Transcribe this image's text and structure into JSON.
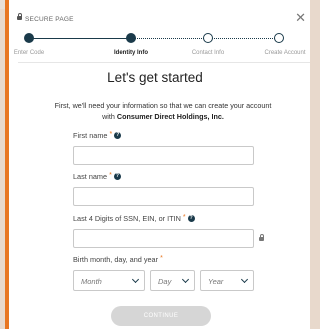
{
  "header": {
    "secure_label": "SECURE PAGE",
    "close_icon": "close-icon"
  },
  "steps": [
    {
      "label": "Enter Code",
      "state": "completed"
    },
    {
      "label": "Identity Info",
      "state": "current"
    },
    {
      "label": "Contact Info",
      "state": "upcoming"
    },
    {
      "label": "Create Account",
      "state": "upcoming"
    }
  ],
  "title": "Let's get started",
  "intro": {
    "text": "First, we'll need your information so that we can create your account with ",
    "company": "Consumer Direct Holdings, Inc."
  },
  "fields": {
    "first_name": {
      "label": "First name",
      "required": "*",
      "value": ""
    },
    "last_name": {
      "label": "Last name",
      "required": "*",
      "value": ""
    },
    "ssn": {
      "label": "Last 4 Digits of SSN, EIN, or ITIN",
      "required": "*",
      "value": ""
    },
    "birth": {
      "label": "Birth month, day, and year",
      "required": "*"
    }
  },
  "birth_selects": {
    "month": "Month",
    "day": "Day",
    "year": "Year"
  },
  "continue_label": "CONTINUE",
  "colors": {
    "accent": "#e87722",
    "primary": "#1a3a4a",
    "button_disabled": "#d6d6d6"
  }
}
